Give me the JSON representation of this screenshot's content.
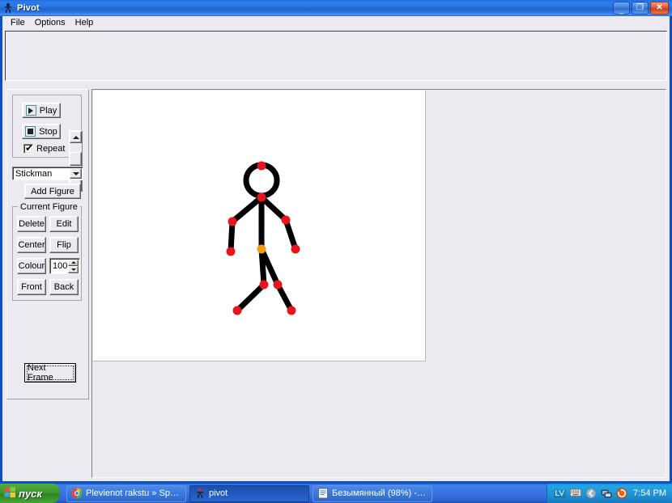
{
  "window": {
    "title": "Pivot",
    "icon": "stickman-icon",
    "buttons": {
      "minimize": "_",
      "maximize": "❐",
      "close": "✕"
    }
  },
  "menubar": {
    "items": [
      {
        "label": "File",
        "name": "menu-file"
      },
      {
        "label": "Options",
        "name": "menu-options"
      },
      {
        "label": "Help",
        "name": "menu-help"
      }
    ]
  },
  "toolpanel": {
    "playback": {
      "play_label": "Play",
      "stop_label": "Stop",
      "repeat_label": "Repeat",
      "repeat_checked": "✔",
      "play_icon": "play-triangle-icon",
      "stop_icon": "stop-square-icon"
    },
    "figure_select": {
      "value": "Stickman",
      "arrow": "▼"
    },
    "add_figure_label": "Add Figure",
    "current_figure": {
      "group_title": "Current Figure",
      "delete_label": "Delete",
      "edit_label": "Edit",
      "center_label": "Center",
      "flip_label": "Flip",
      "colour_label": "Colour",
      "colour_value": "100",
      "front_label": "Front",
      "back_label": "Back"
    },
    "next_frame_label": "Next Frame"
  },
  "canvas": {
    "background": "#ffffff",
    "figure": {
      "name": "stickman",
      "line_color": "#000000",
      "joint_color": "#e8141e",
      "hip_joint_color": "#f59a14"
    }
  },
  "taskbar": {
    "start_label": "пуск",
    "items": [
      {
        "label": "Plevienot rakstu » Sp…",
        "icon": "chrome-icon",
        "active": false
      },
      {
        "label": "pivot",
        "icon": "stickman-icon",
        "active": true
      },
      {
        "label": "Безымянный (98%) -…",
        "icon": "document-icon",
        "active": false
      }
    ],
    "tray": {
      "language": "LV",
      "keyboard_icon": "keyboard-icon",
      "shield_icon": "shield-icon",
      "network_icon": "network-icon",
      "update_icon": "update-icon",
      "clock": "7:54 PM"
    }
  }
}
